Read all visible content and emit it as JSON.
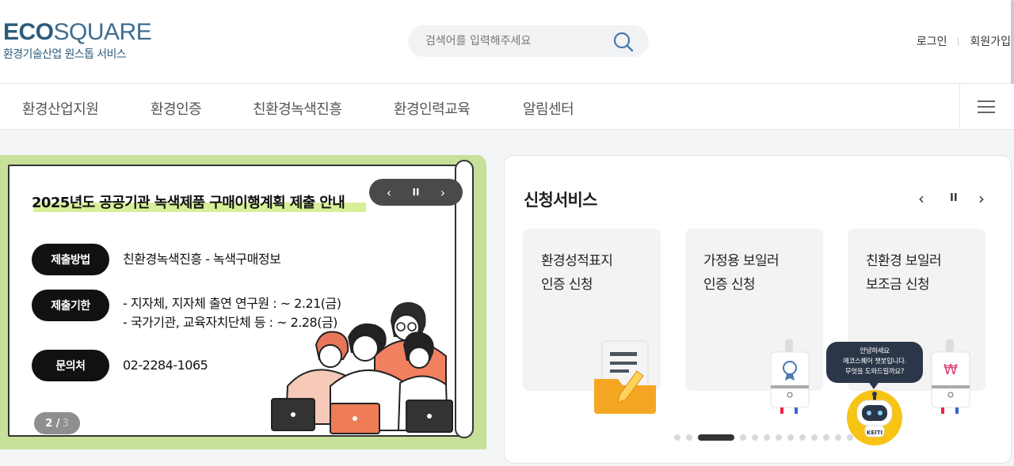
{
  "brand": {
    "logo_bold": "ECO",
    "logo_thin": "SQUARE",
    "tagline": "환경기술산업 원스톱 서비스",
    "color": "#2d5b7c"
  },
  "search": {
    "placeholder": "검색어를 입력해주세요",
    "icon": "search-icon"
  },
  "util": {
    "login": "로그인",
    "signup": "회원가입"
  },
  "nav": {
    "items": [
      "환경산업지원",
      "환경인증",
      "친환경녹색진흥",
      "환경인력교육",
      "알림센터"
    ],
    "menu_icon": "hamburger-icon"
  },
  "banner": {
    "title": "2025년도 공공기관 녹색제품 구매이행계획 제출 안내",
    "rows": [
      {
        "label": "제출방법",
        "lines": [
          "친환경녹색진흥 - 녹색구매정보"
        ]
      },
      {
        "label": "제출기한",
        "lines": [
          "- 지자체, 지자체 출연 연구원 : ~ 2.21(금)",
          "- 국가기관, 교육자치단체 등 : ~ 2.28(금)"
        ]
      },
      {
        "label": "문의처",
        "lines": [
          "02-2284-1065"
        ]
      }
    ],
    "controls": {
      "prev": "‹",
      "pause": "II",
      "next": "›"
    },
    "pager": {
      "current": "2 /",
      "total": "3"
    },
    "bg_color": "#c7e09a"
  },
  "services": {
    "title": "신청서비스",
    "controls": {
      "prev": "‹",
      "pause": "II",
      "next": "›"
    },
    "cards": [
      {
        "line1": "환경성적표지",
        "line2": "인증 신청"
      },
      {
        "line1": "가정용 보일러",
        "line2": "인증 신청"
      },
      {
        "line1": "친환경 보일러",
        "line2": "보조금 신청"
      }
    ],
    "dots": {
      "count": 14,
      "active": 2
    }
  },
  "chatbot": {
    "greeting": [
      "안녕하세요",
      "에코스퀘어 챗봇입니다.",
      "무엇을 도와드릴까요?"
    ],
    "badge": "KEITI"
  }
}
